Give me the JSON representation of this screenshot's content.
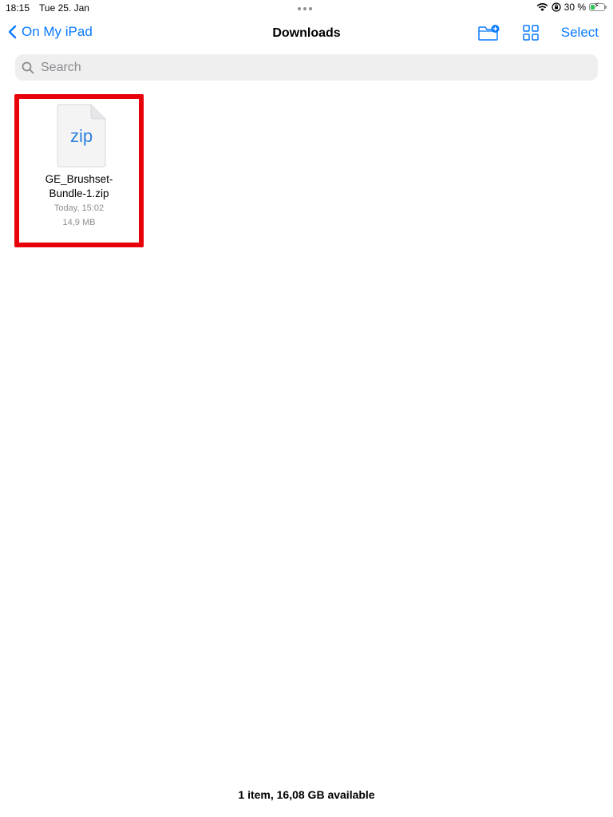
{
  "status_bar": {
    "time": "18:15",
    "date": "Tue 25. Jan",
    "battery_percent": "30 %",
    "battery_level": 0.3
  },
  "nav": {
    "back_label": "On My iPad",
    "title": "Downloads",
    "select_label": "Select"
  },
  "search": {
    "placeholder": "Search",
    "value": ""
  },
  "files": [
    {
      "icon_label": "zip",
      "name": "GE_Brushset-Bundle-1.zip",
      "name_line1": "GE_Brushset-",
      "name_line2": "Bundle-1.zip",
      "date": "Today, 15:02",
      "size": "14,9 MB"
    }
  ],
  "footer": {
    "summary": "1 item, 16,08 GB available"
  },
  "colors": {
    "accent": "#0a7aff",
    "highlight_border": "#e8000a",
    "battery_fill": "#34c759"
  },
  "icons": {
    "back": "chevron-left-icon",
    "new_folder": "folder-plus-icon",
    "view_toggle": "grid-icon",
    "search": "search-icon",
    "wifi": "wifi-icon",
    "orientation_lock": "orientation-lock-icon",
    "battery": "battery-charging-icon"
  }
}
